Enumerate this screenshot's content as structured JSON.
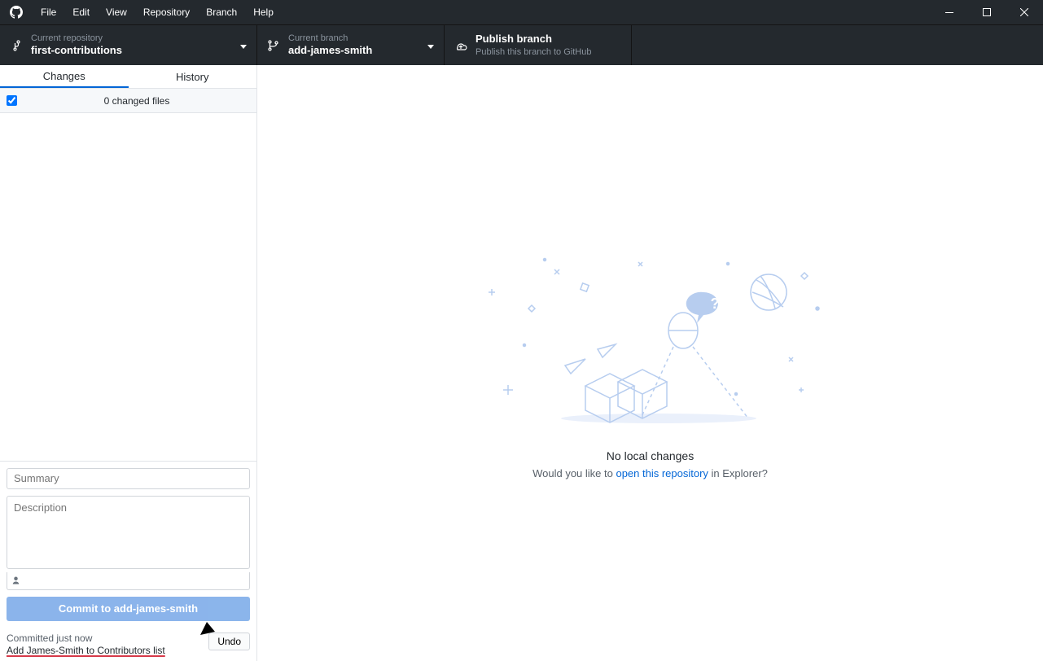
{
  "menu": [
    "File",
    "Edit",
    "View",
    "Repository",
    "Branch",
    "Help"
  ],
  "toolbar": {
    "repo": {
      "label": "Current repository",
      "value": "first-contributions"
    },
    "branch": {
      "label": "Current branch",
      "value": "add-james-smith"
    },
    "publish": {
      "label": "Publish branch",
      "sub": "Publish this branch to GitHub"
    }
  },
  "tabs": {
    "changes": "Changes",
    "history": "History"
  },
  "changes_header": "0 changed files",
  "commit": {
    "summary_placeholder": "Summary",
    "description_placeholder": "Description",
    "button_prefix": "Commit to ",
    "button_branch": "add-james-smith"
  },
  "status": {
    "time": "Committed just now",
    "message": "Add James-Smith to Contributors list",
    "undo": "Undo"
  },
  "empty": {
    "title": "No local changes",
    "sub_pre": "Would you like to ",
    "link": "open this repository",
    "sub_post": " in Explorer?"
  }
}
